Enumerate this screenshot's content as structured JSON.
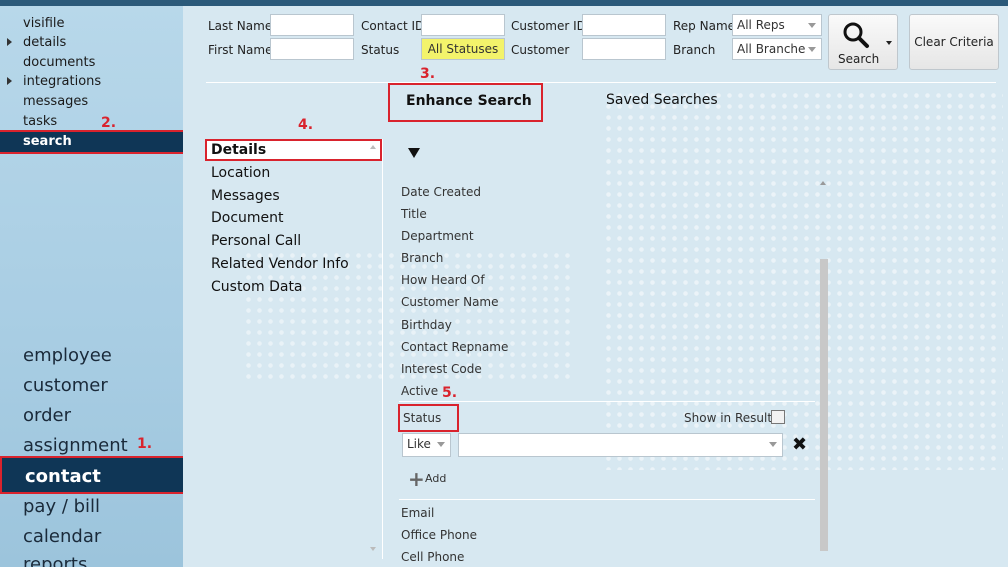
{
  "sidebar": {
    "sub_items": [
      "visifile",
      "details",
      "documents",
      "integrations",
      "messages",
      "tasks",
      "search"
    ],
    "main_items": [
      "employee",
      "customer",
      "order",
      "assignment",
      "contact",
      "pay / bill",
      "calendar",
      "reports"
    ]
  },
  "annotations": {
    "a1": "1.",
    "a2": "2.",
    "a3": "3.",
    "a4": "4.",
    "a5": "5."
  },
  "filters": {
    "last_name": "Last Name",
    "first_name": "First Name",
    "contact_id": "Contact ID",
    "status": "Status",
    "status_value": "All Statuses",
    "customer_id": "Customer ID",
    "customer": "Customer",
    "rep_name": "Rep Name",
    "rep_value": "All Reps",
    "branch": "Branch",
    "branch_value": "All Branche",
    "search_button": "Search",
    "clear_button": "Clear Criteria"
  },
  "tabs": {
    "enhance": "Enhance Search",
    "saved": "Saved Searches"
  },
  "categories": [
    "Details",
    "Location",
    "Messages",
    "Document",
    "Personal Call",
    "Related Vendor Info",
    "Custom Data"
  ],
  "fields_top": [
    "Date Created",
    "Title",
    "Department",
    "Branch",
    "How Heard Of",
    "Customer Name",
    "Birthday",
    "Contact Repname",
    "Interest Code",
    "Active"
  ],
  "status_row": {
    "label": "Status",
    "show_in_results": "Show in Results",
    "operator": "Like",
    "add": "Add"
  },
  "fields_bottom": [
    "Email",
    "Office Phone",
    "Cell Phone"
  ]
}
